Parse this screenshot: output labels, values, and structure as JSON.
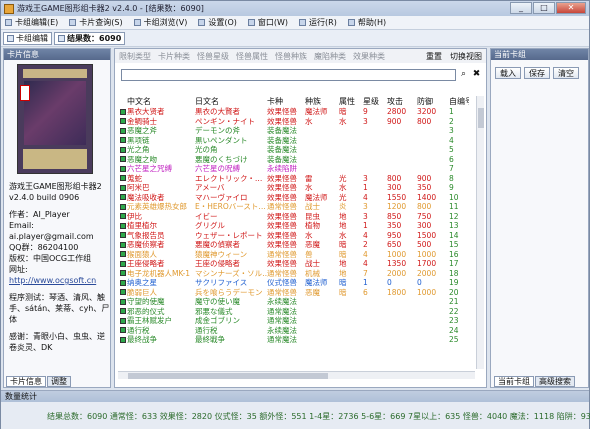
{
  "window": {
    "title": "游戏王GAME图形组卡器2 v2.4.0 - [结果数：6090]"
  },
  "menu": [
    "卡组编辑(E)",
    "卡片查询(S)",
    "卡组浏览(V)",
    "设置(O)",
    "窗口(W)",
    "运行(R)",
    "帮助(H)"
  ],
  "toolbar": {
    "deck": "卡组编辑",
    "result": "结果数：6090"
  },
  "left_panel": {
    "title": "卡片信息",
    "info": [
      "游戏王GAME图形组卡器2",
      "v2.4.0 build 0906",
      "作者：AI_Player",
      "Email:",
      "ai.player@gmail.com",
      "QQ群：86204100",
      "版权：中国OCG工作组",
      "网址:",
      "http://www.ocgsoft.cn",
      "程序测试：琴酒、清风、触手、sátán、莱蒂、cyh、尸体",
      "感谢：青眼小白、虫虫、逆卷炎灵、DK"
    ],
    "tabs": [
      "卡片信息",
      "调整"
    ]
  },
  "center": {
    "filters": [
      "限制类型",
      "卡片种类",
      "怪兽星级",
      "怪兽属性",
      "怪兽种族",
      "魔陷种类",
      "效果种类"
    ],
    "right_actions": [
      "重置",
      "切换视图"
    ],
    "headers": [
      "中文名",
      "日文名",
      "卡种",
      "种族",
      "属性",
      "星级",
      "攻击",
      "防御",
      "自编号"
    ],
    "rows": [
      [
        "黑衣大贤者",
        "黒衣の大賢者",
        "效果怪兽",
        "魔法师",
        "暗",
        "9",
        "2800",
        "3200",
        "1",
        "#d01818"
      ],
      [
        "金鲷骑士",
        "ペンギン・ナイト",
        "效果怪兽",
        "水",
        "水",
        "3",
        "900",
        "800",
        "2",
        "#d01818"
      ],
      [
        "恶魔之斧",
        "デーモンの斧",
        "装备魔法",
        "",
        "",
        "",
        "",
        "",
        "3",
        "#2a8a2a"
      ],
      [
        "黑项链",
        "黒いペンダント",
        "装备魔法",
        "",
        "",
        "",
        "",
        "",
        "4",
        "#2a8a2a"
      ],
      [
        "光之角",
        "光の角",
        "装备魔法",
        "",
        "",
        "",
        "",
        "",
        "5",
        "#2a8a2a"
      ],
      [
        "恶魔之吻",
        "悪魔のくちづけ",
        "装备魔法",
        "",
        "",
        "",
        "",
        "",
        "6",
        "#2a8a2a"
      ],
      [
        "六芒星之咒缚",
        "六芒星の呪縛",
        "永续陷阱",
        "",
        "",
        "",
        "",
        "",
        "7",
        "#c020c0"
      ],
      [
        "蒐蛇",
        "エレクトリック・…",
        "效果怪兽",
        "雷",
        "光",
        "3",
        "800",
        "900",
        "8",
        "#d01818"
      ],
      [
        "阿米巴",
        "アメーバ",
        "效果怪兽",
        "水",
        "水",
        "1",
        "300",
        "350",
        "9",
        "#d01818"
      ],
      [
        "魔法吸收者",
        "マハーヴァイロ",
        "效果怪兽",
        "魔法师",
        "光",
        "4",
        "1550",
        "1400",
        "10",
        "#d01818"
      ],
      [
        "元素英雄爆热女郎",
        "E・HEROバースト…",
        "通常怪兽",
        "战士",
        "炎",
        "3",
        "1200",
        "800",
        "11",
        "#e09a30"
      ],
      [
        "伊比",
        "イビー",
        "效果怪兽",
        "昆虫",
        "地",
        "3",
        "850",
        "750",
        "12",
        "#d01818"
      ],
      [
        "植里植尔",
        "グリグル",
        "效果怪兽",
        "植物",
        "地",
        "1",
        "350",
        "300",
        "13",
        "#d01818"
      ],
      [
        "气象报告员",
        "ウェザー・レポート",
        "效果怪兽",
        "水",
        "水",
        "4",
        "950",
        "1500",
        "14",
        "#d01818"
      ],
      [
        "恶魔侦察者",
        "悪魔の偵察者",
        "效果怪兽",
        "恶魔",
        "暗",
        "2",
        "650",
        "500",
        "15",
        "#d01818"
      ],
      [
        "猴面猿人",
        "猿魔神ウィーン",
        "通常怪兽",
        "兽",
        "暗",
        "4",
        "1000",
        "1000",
        "16",
        "#e09a30"
      ],
      [
        "王座侵略者",
        "王座の侵略者",
        "效果怪兽",
        "战士",
        "地",
        "4",
        "1350",
        "1700",
        "17",
        "#d01818"
      ],
      [
        "电子龙机器人MK-1",
        "マシンナーズ・ソル…",
        "通常怪兽",
        "机械",
        "地",
        "7",
        "2000",
        "2000",
        "18",
        "#e09a30"
      ],
      [
        "纳奥之星",
        "サクリファイス",
        "仪式怪兽",
        "魔法师",
        "暗",
        "1",
        "0",
        "0",
        "19",
        "#2060d0"
      ],
      [
        "脆弱巨人",
        "兵を喰らうデーモン",
        "通常怪兽",
        "恶魔",
        "暗",
        "6",
        "1800",
        "1000",
        "20",
        "#e09a30"
      ],
      [
        "守望的使魔",
        "魔守の使い魔",
        "永续魔法",
        "",
        "",
        "",
        "",
        "",
        "21",
        "#2a8a2a"
      ],
      [
        "邪恶的仪式",
        "邪悪な儀式",
        "通常魔法",
        "",
        "",
        "",
        "",
        "",
        "22",
        "#2a8a2a"
      ],
      [
        "霸王林赋发户",
        "成金ゴブリン",
        "通常魔法",
        "",
        "",
        "",
        "",
        "",
        "23",
        "#2a8a2a"
      ],
      [
        "通行税",
        "通行税",
        "永续魔法",
        "",
        "",
        "",
        "",
        "",
        "24",
        "#2a8a2a"
      ],
      [
        "最终战争",
        "最終戦争",
        "通常魔法",
        "",
        "",
        "",
        "",
        "",
        "25",
        "#2a8a2a"
      ]
    ]
  },
  "right_panel": {
    "title": "当前卡组",
    "buttons": [
      "载入",
      "保存",
      "清空"
    ],
    "tabs": [
      "当前卡组",
      "高级搜索"
    ]
  },
  "status": {
    "title": "数量统计",
    "text": "结果总数：6090  通常怪：633  效果怪：2820  仪式怪：35  额外怪：551  1-4星：2736  5-6星：669  7星以上：635  怪兽：4040  魔法：1118  陷阱：932"
  },
  "window_controls": [
    "_",
    "□",
    "✕"
  ],
  "icons": {
    "search": "⌕",
    "clear": "✖"
  }
}
